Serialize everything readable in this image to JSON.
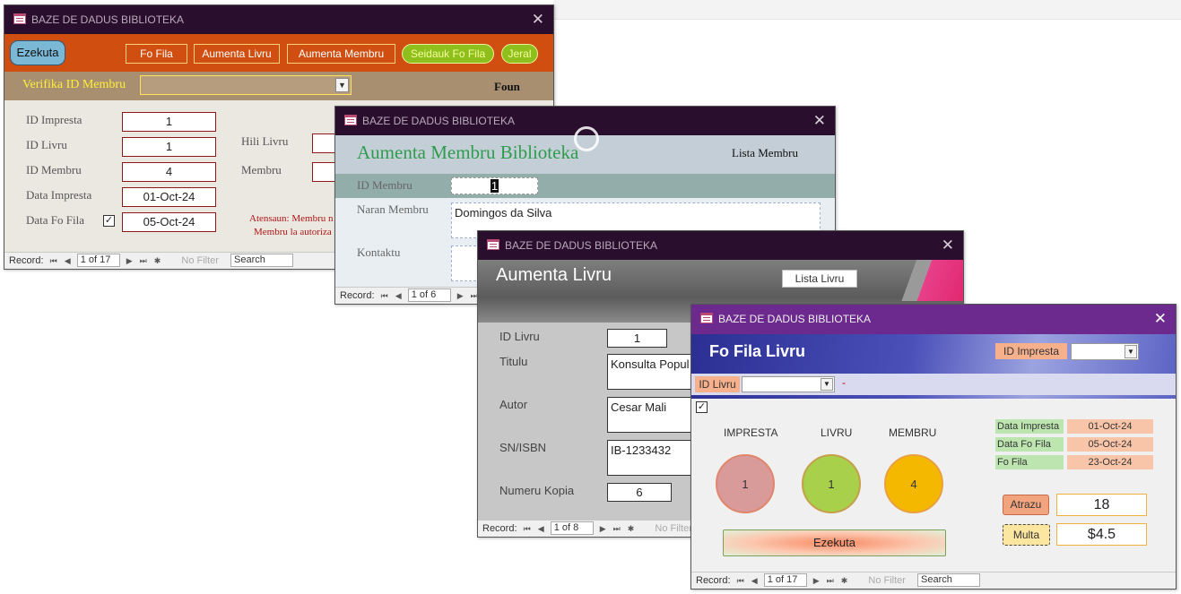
{
  "window_title": "BAZE DE DADUS BIBLIOTEKA",
  "record_label": "Record:",
  "no_filter": "No Filter",
  "search_label": "Search",
  "win1": {
    "ezekuta": "Ezekuta",
    "buttons": [
      "Fo Fila",
      "Aumenta Livru",
      "Aumenta Membru",
      "Seidauk Fo Fila",
      "Jeral"
    ],
    "verifika_label": "Verifika ID Membru",
    "foun": "Foun",
    "labels": [
      "ID Impresta",
      "ID Livru",
      "ID Membru",
      "Data Impresta",
      "Data Fo Fila"
    ],
    "values": [
      "1",
      "1",
      "4",
      "01-Oct-24",
      "05-Oct-24"
    ],
    "hili_livru": "Hili Livru",
    "membru": "Membru",
    "atensaun_1": "Atensaun: Membru n",
    "atensaun_2": "Membru la autoriza",
    "record_pos": "1 of 17"
  },
  "win2": {
    "heading": "Aumenta Membru Biblioteka",
    "lista": "Lista Membru",
    "id_label": "ID Membru",
    "id_value": "1",
    "naran_label": "Naran Membru",
    "naran_value": "Domingos da Silva",
    "kontaktu_label": "Kontaktu",
    "record_pos": "1 of 6"
  },
  "win3": {
    "heading": "Aumenta Livru",
    "lista": "Lista Livru",
    "labels": [
      "ID Livru",
      "Titulu",
      "Autor",
      "SN/ISBN",
      "Numeru Kopia"
    ],
    "values": [
      "1",
      "Konsulta Popul",
      "Cesar Mali",
      "IB-1233432",
      "6"
    ],
    "record_pos": "1 of 8"
  },
  "win4": {
    "heading": "Fo Fila Livru",
    "id_impresta_label": "ID Impresta",
    "id_livru_label": "ID Livru",
    "dash": "-",
    "col_labels": [
      "IMPRESTA",
      "LIVRU",
      "MEMBRU"
    ],
    "circle_values": [
      "1",
      "1",
      "4"
    ],
    "date_labels": [
      "Data Impresta",
      "Data Fo Fila",
      "Fo Fila"
    ],
    "date_values": [
      "01-Oct-24",
      "05-Oct-24",
      "23-Oct-24"
    ],
    "atrazu_label": "Atrazu",
    "atrazu_value": "18",
    "multa_label": "Multa",
    "multa_value": "$4.5",
    "ezekuta": "Ezekuta",
    "record_pos": "1 of 17"
  },
  "colors": {
    "titlebar": "#2a0e2e",
    "w1_button_bar": "#d04e10",
    "w2_heading": "#2e9c4e",
    "w4_titlebar": "#6d2a8e",
    "circle_impresta": "#d99a9a",
    "circle_livru": "#a8d04a",
    "circle_membru": "#f5b800"
  }
}
